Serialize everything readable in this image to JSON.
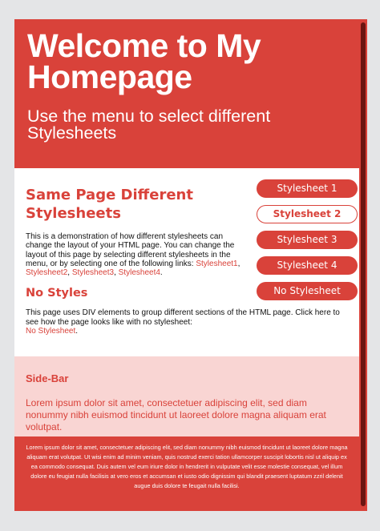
{
  "header": {
    "title": "Welcome to My Homepage",
    "subtitle": "Use the menu to select different Stylesheets"
  },
  "main": {
    "heading": "Same Page Different Stylesheets",
    "intro": "This is a demonstration of how different stylesheets can change the layout of your HTML page. You can change the layout of this page by selecting different stylesheets in the menu, or by selecting one of the following links:",
    "links": [
      "Stylesheet1",
      "Stylesheet2",
      "Stylesheet3",
      "Stylesheet4"
    ],
    "link_sep": ", ",
    "end_punct": "."
  },
  "no_styles": {
    "heading": "No Styles",
    "text": "This page uses DIV elements to group different sections of the HTML page. Click here to see how the page looks like with no stylesheet:",
    "link": "No Stylesheet",
    "end_punct": "."
  },
  "menu": {
    "items": [
      {
        "label": "Stylesheet 1",
        "active": false
      },
      {
        "label": "Stylesheet 2",
        "active": true
      },
      {
        "label": "Stylesheet 3",
        "active": false
      },
      {
        "label": "Stylesheet 4",
        "active": false
      },
      {
        "label": "No Stylesheet",
        "active": false
      }
    ]
  },
  "sidebar": {
    "heading": "Side-Bar",
    "text": "Lorem ipsum dolor sit amet, consectetuer adipiscing elit, sed diam nonummy nibh euismod tincidunt ut laoreet dolore magna aliquam erat volutpat."
  },
  "footer": {
    "text": "Lorem ipsum dolor sit amet, consectetuer adipiscing elit, sed diam nonummy nibh euismod tincidunt ut laoreet dolore magna aliquam erat volutpat. Ut wisi enim ad minim veniam, quis nostrud exerci tation ullamcorper suscipit lobortis nisl ut aliquip ex ea commodo consequat. Duis autem vel eum iriure dolor in hendrerit in vulputate velit esse molestie consequat, vel illum dolore eu feugiat nulla facilisis at vero eros et accumsan et iusto odio dignissim qui blandit praesent luptatum zzril delenit augue duis dolore te feugait nulla facilisi."
  },
  "colors": {
    "accent": "#d9423a",
    "sidebar_bg": "#f9d5d3",
    "page_bg": "#e4e5e7",
    "scrollbar_thumb": "#6b1612"
  }
}
